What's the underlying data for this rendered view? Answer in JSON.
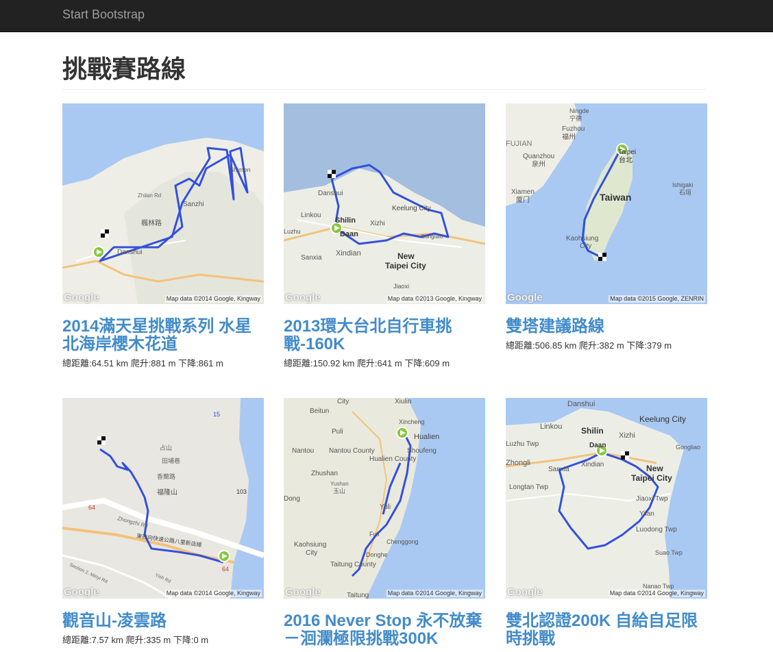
{
  "navbar": {
    "brand": "Start Bootstrap"
  },
  "page": {
    "title": "挑戰賽路線"
  },
  "routes": [
    {
      "title": "2014滿天星挑戰系列 水星北海岸櫻木花道",
      "stats": "總距離:64.51 km 爬升:881 m 下降:861 m",
      "map_attribution": "Map data ©2014 Google, Kingway",
      "map_logo": "Google"
    },
    {
      "title": "2013環大台北自行車挑戰-160K",
      "stats": "總距離:150.92 km 爬升:641 m 下降:609 m",
      "map_attribution": "Map data ©2013 Google, Kingway",
      "map_logo": "Google"
    },
    {
      "title": "雙塔建議路線",
      "stats": "總距離:506.85 km 爬升:382 m 下降:379 m",
      "map_attribution": "Map data ©2015 Google, ZENRIN",
      "map_logo": "Google"
    },
    {
      "title": "觀音山-凌雲路",
      "stats": "總距離:7.57 km 爬升:335 m 下降:0 m",
      "map_attribution": "Map data ©2014 Google, Kingway",
      "map_logo": "Google"
    },
    {
      "title": "2016 Never Stop 永不放棄－洄瀾極限挑戰300K",
      "stats": "",
      "map_attribution": "Map data ©2014 Google, Kingway",
      "map_logo": "Google"
    },
    {
      "title": "雙北認證200K 自給自足限時挑戰",
      "stats": "",
      "map_attribution": "Map data ©2014 Google, Kingway",
      "map_logo": "Google"
    }
  ],
  "map_labels": {
    "m1": [
      "Shimen",
      "Sanzhi",
      "楓林路",
      "Danshui",
      "Zhilan Rd"
    ],
    "m2": [
      "Danshui",
      "Linkou",
      "Shilin",
      "Daan",
      "Xizhi",
      "Keelung City",
      "Gongliao",
      "Sanxia",
      "Xindian",
      "New",
      "Taipei City",
      "Jiaoxi",
      "Luzhu"
    ],
    "m3": [
      "Ningde",
      "宁德",
      "Fuzhou",
      "福州",
      "FUJIAN",
      "Quanzhou",
      "泉州",
      "Xiamen",
      "厦门",
      "Taipei",
      "台北",
      "Taiwan",
      "Ishigaki",
      "石垣",
      "Kaohsiung",
      "City"
    ],
    "m4": [
      "占山",
      "田埔巷",
      "香蘭路",
      "福隆山",
      "Zhongzhi Rd",
      "東西向快速公路八里新店線",
      "Section 2, Minyi Rd",
      "Yish Rd",
      "103",
      "15",
      "64",
      "64"
    ],
    "m5": [
      "City",
      "Xiulin",
      "Beitun",
      "Puli",
      "Xincheng",
      "Hualien",
      "Shoufeng",
      "Nantou",
      "Nantou County",
      "Hualien County",
      "Zhushan",
      "Yushan",
      "玉山",
      "Dong",
      "Yuli",
      "Fuli",
      "Chenggong",
      "Kaohsiung",
      "City",
      "Donghe",
      "Taitung County",
      "Taitung"
    ],
    "m6": [
      "Danshui",
      "Keelung City",
      "Linkou",
      "Shilin",
      "Xizhi",
      "Luzhu Twp",
      "Daan",
      "Gongliao",
      "Zhongli",
      "Sanxia",
      "Xindian",
      "New",
      "Taipei City",
      "Longtan Twp",
      "Jiaoxi Twp",
      "Yilan",
      "Luodong Twp",
      "Suao Twp",
      "Nanao Twp"
    ]
  },
  "colors": {
    "brand_link": "#428bca",
    "navbar": "#222222",
    "route": "#3350dd",
    "water": "#a8c8f5",
    "land": "#f0efe8"
  }
}
